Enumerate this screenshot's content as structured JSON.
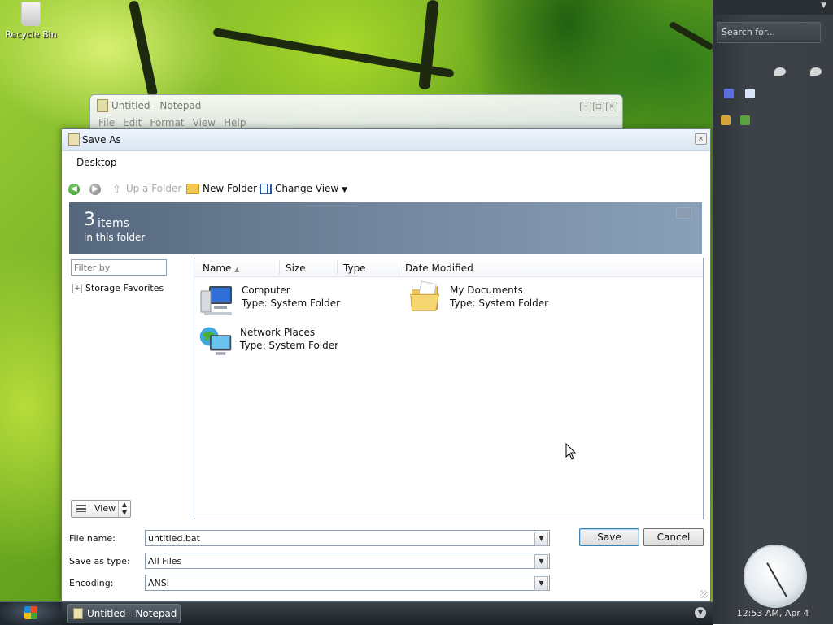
{
  "desktop": {
    "recycle_bin_label": "Recycle Bin"
  },
  "notepad": {
    "title": "Untitled - Notepad",
    "menu": [
      "File",
      "Edit",
      "Format",
      "View",
      "Help"
    ]
  },
  "dialog": {
    "title": "Save As",
    "address": "Desktop",
    "toolbar": {
      "up_folder": "Up a Folder",
      "new_folder": "New Folder",
      "change_view": "Change View"
    },
    "banner": {
      "count": "3",
      "items_word": "items",
      "subtitle": "in this folder"
    },
    "filter_placeholder": "Filter by",
    "storage_favorites": "Storage Favorites",
    "view_button": "View",
    "columns": [
      "Name",
      "Size",
      "Type",
      "Date Modified"
    ],
    "files": [
      {
        "name": "Computer",
        "type": "Type: System Folder",
        "icon": "computer-icon"
      },
      {
        "name": "My Documents",
        "type": "Type: System Folder",
        "icon": "documents-folder-icon"
      },
      {
        "name": "Network Places",
        "type": "Type: System Folder",
        "icon": "network-places-icon"
      }
    ],
    "fields": {
      "file_name_label": "File name:",
      "file_name_value": "untitled.bat",
      "save_type_label": "Save as type:",
      "save_type_value": "All Files",
      "encoding_label": "Encoding:",
      "encoding_value": "ANSI"
    },
    "save_label": "Save",
    "cancel_label": "Cancel"
  },
  "sidebar": {
    "search_placeholder": "Search for...",
    "clock_text": "12:53 AM, Apr 4"
  },
  "taskbar": {
    "task_label": "Untitled - Notepad"
  },
  "colors": {
    "banner": "#6e8198",
    "sidebar": "#3c4248",
    "taskbar": "#2a3036"
  }
}
